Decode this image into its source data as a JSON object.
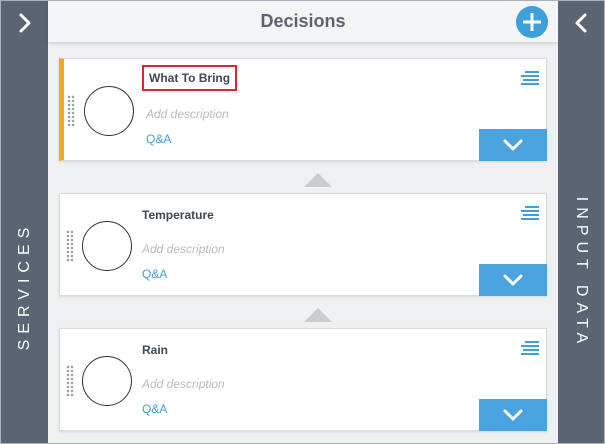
{
  "header": {
    "title": "Decisions"
  },
  "left_panel": {
    "label": "SERVICES"
  },
  "right_panel": {
    "label": "INPUT DATA"
  },
  "cards": [
    {
      "title": "What To Bring",
      "description_placeholder": "Add description",
      "link": "Q&A",
      "selected": true
    },
    {
      "title": "Temperature",
      "description_placeholder": "Add description",
      "link": "Q&A",
      "selected": false
    },
    {
      "title": "Rain",
      "description_placeholder": "Add description",
      "link": "Q&A",
      "selected": false
    }
  ],
  "colors": {
    "side_panel": "#5a6472",
    "accent_blue": "#3d9fdb",
    "selected_bar": "#f5a623",
    "highlight_box": "#d9272e"
  },
  "icons": {
    "left_panel": "chevron-right-icon",
    "right_panel": "chevron-left-icon",
    "add": "plus-icon",
    "card_menu": "menu-lines-icon",
    "expand": "chevron-down-icon",
    "drag": "drag-handle-icon",
    "connector": "triangle-up-icon"
  }
}
